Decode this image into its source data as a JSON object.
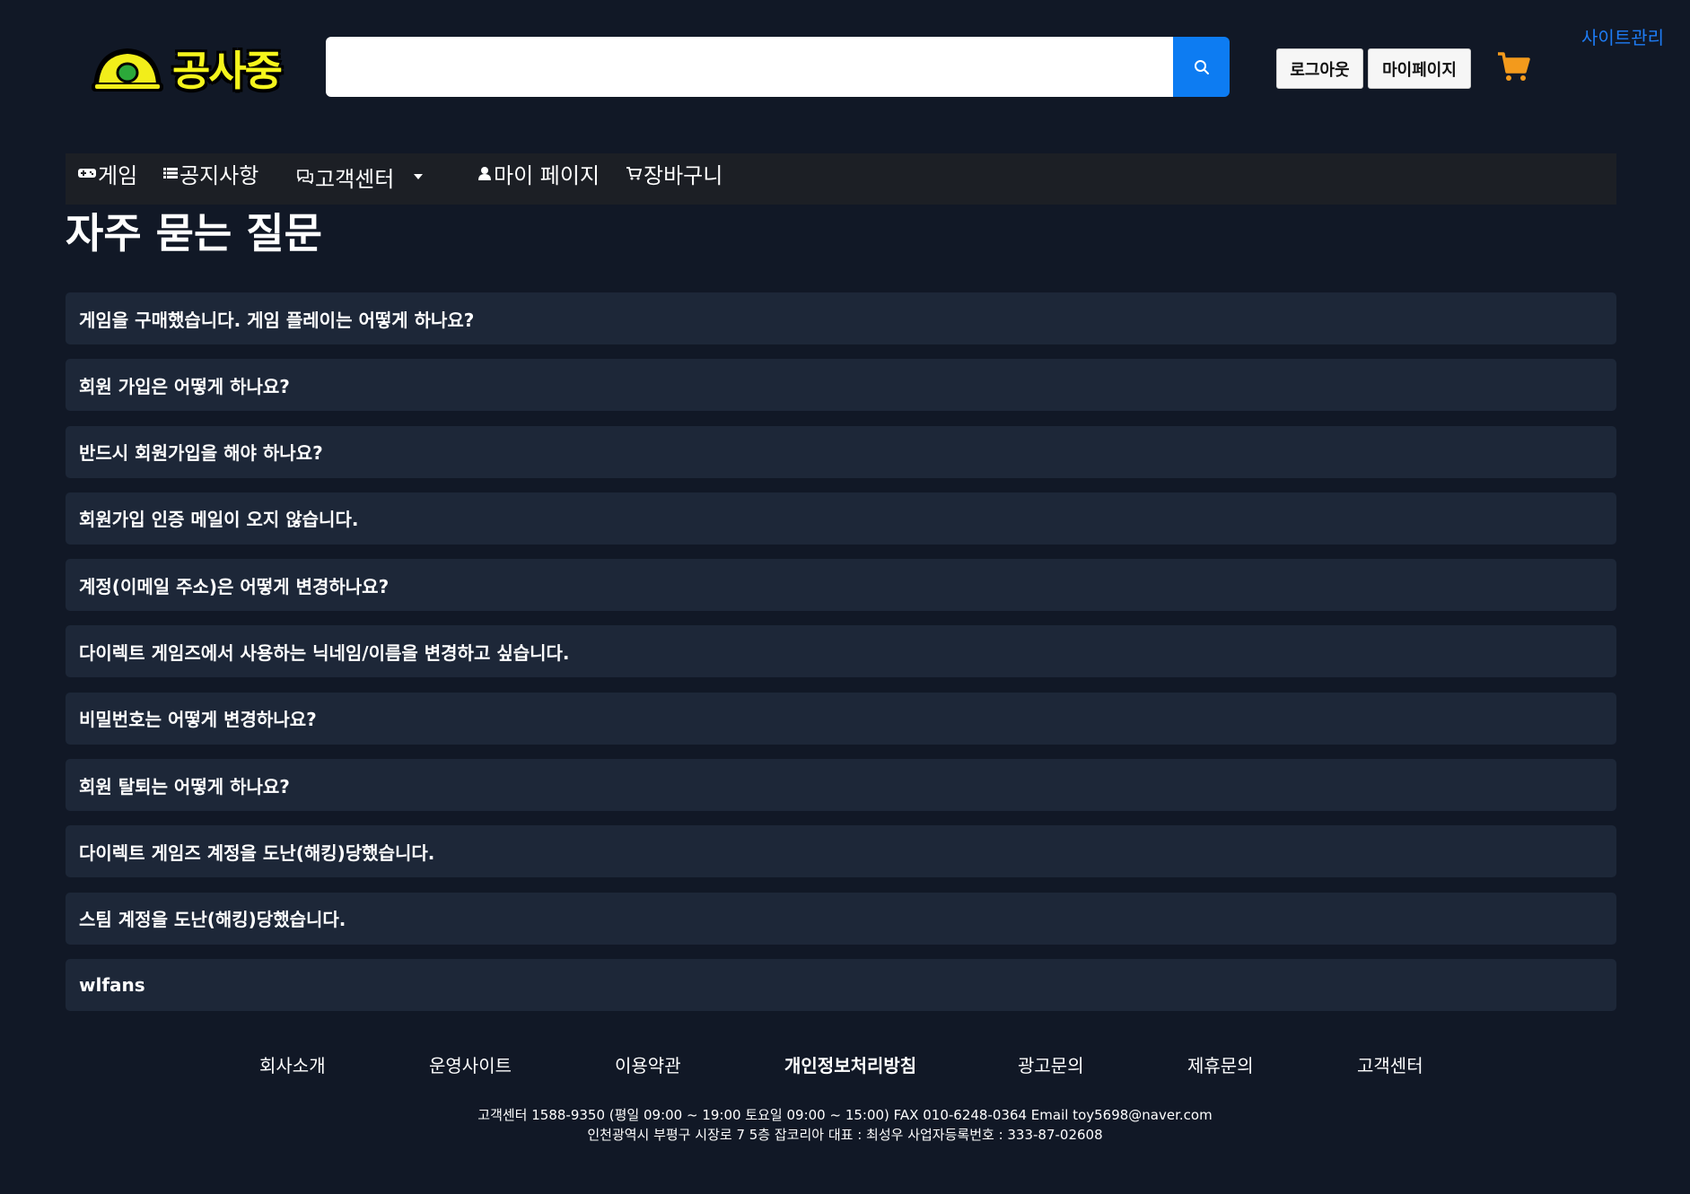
{
  "header": {
    "logo_text": "공사중",
    "search": {
      "value": "",
      "placeholder": ""
    },
    "logout_label": "로그아웃",
    "mypage_label": "마이페이지",
    "admin_link": "사이트관리",
    "search_icon": "search-icon",
    "cart_icon": "cart-icon"
  },
  "nav": {
    "items": [
      {
        "label": "게임",
        "icon": "gamepad-icon"
      },
      {
        "label": "공지사항",
        "icon": "list-icon"
      },
      {
        "label": "고객센터",
        "icon": "chat-icon"
      },
      {
        "label": "마이 페이지",
        "icon": "person-icon"
      },
      {
        "label": "장바구니",
        "icon": "cart-icon"
      }
    ]
  },
  "main": {
    "title": "자주 묻는 질문",
    "faq": [
      "게임을 구매했습니다. 게임 플레이는 어떻게 하나요?",
      "회원 가입은 어떻게 하나요?",
      "반드시 회원가입을 해야 하나요?",
      "회원가입 인증 메일이 오지 않습니다.",
      "계정(이메일 주소)은 어떻게 변경하나요?",
      "다이렉트 게임즈에서 사용하는 닉네임/이름을 변경하고 싶습니다.",
      "비밀번호는 어떻게 변경하나요?",
      "회원 탈퇴는 어떻게 하나요?",
      "다이렉트 게임즈 계정을 도난(해킹)당했습니다.",
      "스팀 계정을 도난(해킹)당했습니다.",
      "wlfans"
    ]
  },
  "footer": {
    "links": [
      "회사소개",
      "운영사이트",
      "이용약관",
      "개인정보처리방침",
      "광고문의",
      "제휴문의",
      "고객센터"
    ],
    "info_line1": "고객센터 1588-9350 (평일 09:00 ~ 19:00 토요일 09:00 ~ 15:00) FAX 010-6248-0364 Email toy5698@naver.com",
    "info_line2": "인천광역시 부평구 시장로 7 5층 잡코리아 대표 : 최성우 사업자등록번호 : 333-87-02608"
  },
  "colors": {
    "background": "#111826",
    "faq_item": "#1d2738",
    "nav": "#1c1f25",
    "accent_blue": "#0d7cf2",
    "admin_link": "#1e7cf5",
    "cart_orange": "#f39a1c",
    "logo_yellow": "#f5f51c"
  }
}
